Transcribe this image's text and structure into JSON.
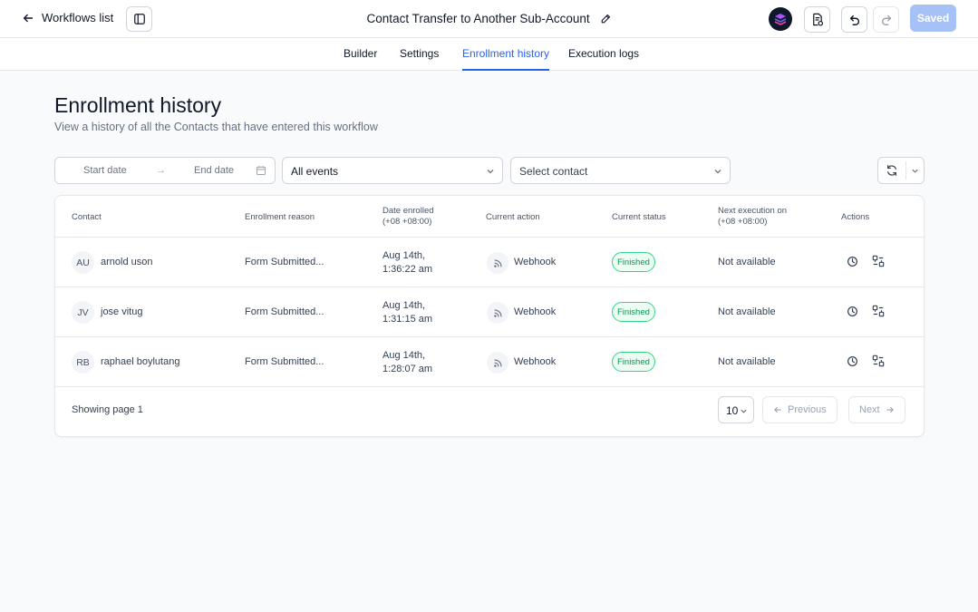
{
  "topbar": {
    "back_label": "Workflows list",
    "workflow_title": "Contact Transfer to Another Sub-Account",
    "saved_label": "Saved"
  },
  "tabs": [
    {
      "label": "Builder",
      "active": false
    },
    {
      "label": "Settings",
      "active": false
    },
    {
      "label": "Enrollment history",
      "active": true
    },
    {
      "label": "Execution logs",
      "active": false
    }
  ],
  "page": {
    "title": "Enrollment history",
    "subtitle": "View a history of all the Contacts that have entered this workflow"
  },
  "filters": {
    "start_date_placeholder": "Start date",
    "end_date_placeholder": "End date",
    "events_value": "All events",
    "contact_placeholder": "Select contact"
  },
  "table": {
    "headers": {
      "contact": "Contact",
      "reason": "Enrollment reason",
      "date_line1": "Date enrolled",
      "date_line2": "(+08 +08:00)",
      "action": "Current action",
      "status": "Current status",
      "next_line1": "Next execution on",
      "next_line2": "(+08 +08:00)",
      "actions": "Actions"
    },
    "rows": [
      {
        "initials": "AU",
        "name": "arnold uson",
        "reason": "Form Submitted...",
        "date_line1": "Aug 14th,",
        "date_line2": "1:36:22 am",
        "action": "Webhook",
        "status": "Finished",
        "next": "Not available"
      },
      {
        "initials": "JV",
        "name": "jose vitug",
        "reason": "Form Submitted...",
        "date_line1": "Aug 14th,",
        "date_line2": "1:31:15 am",
        "action": "Webhook",
        "status": "Finished",
        "next": "Not available"
      },
      {
        "initials": "RB",
        "name": "raphael boylutang",
        "reason": "Form Submitted...",
        "date_line1": "Aug 14th,",
        "date_line2": "1:28:07 am",
        "action": "Webhook",
        "status": "Finished",
        "next": "Not available"
      }
    ]
  },
  "pagination": {
    "showing": "Showing page 1",
    "page_size": "10",
    "previous": "Previous",
    "next": "Next"
  },
  "colors": {
    "accent": "#2563eb",
    "saved_button": "#a5c1f5",
    "status_green": "#039855"
  },
  "icons": {
    "back": "arrow-left-icon",
    "sidebar": "sidebar-panel-icon",
    "edit": "pencil-icon",
    "brand": "brand-logo-icon",
    "test": "document-test-icon",
    "undo": "undo-icon",
    "redo": "redo-icon",
    "calendar": "calendar-icon",
    "refresh": "refresh-icon",
    "webhook": "webhook-rss-icon",
    "history": "clock-history-icon",
    "details": "execution-details-icon"
  }
}
